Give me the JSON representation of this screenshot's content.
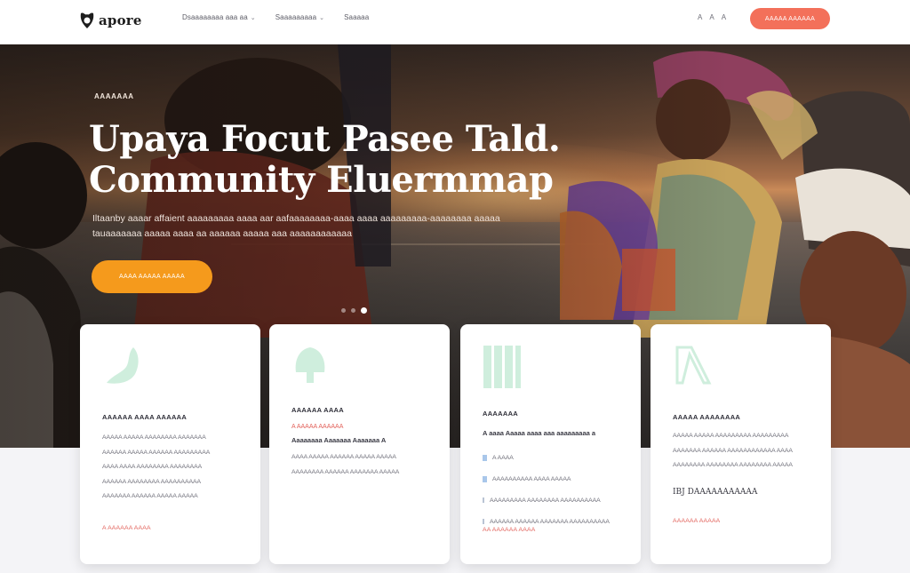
{
  "nav": {
    "logo_text": "apore",
    "links": [
      "Dsaaaaaaaa aaa aa",
      "Saaaaaaaaa",
      "Saaaaa"
    ],
    "right": [
      "A",
      "A",
      "A"
    ],
    "cta_label": "AAAAA AAAAAA"
  },
  "hero": {
    "eyebrow": "AAAAAAA",
    "headline_line1": "Upaya Focut Pasee Tald.",
    "headline_line2": "Community Eluermmap",
    "sub_line1": "Iltaanby aaaar affaient aaaaaaaaa aaaa aar aafaaaaaaaa-aaaa aaaa aaaaaaaaa-aaaaaaaa aaaaa",
    "sub_line2": "tauaaaaaaa aaaaa aaaa aa aaaaaa aaaaa aaa aaaaaaaaaaaa",
    "button_label": "AAAA AAAAA AAAAA",
    "slides": 3,
    "active_slide": 3
  },
  "cards": [
    {
      "title": "AAAAAA AAAA AAAAAA",
      "lines": [
        "AAAAA AAAAA AAAAAAAA AAAAAAA",
        "AAAAAA AAAAA AAAAAA AAAAAAAAA",
        "AAAA AAAA AAAAAAAA AAAAAAAA",
        "AAAAAA AAAAAAAA AAAAAAAAAA",
        "AAAAAAA AAAAAA AAAAA AAAAA"
      ],
      "link": "A AAAAAA AAAA"
    },
    {
      "title": "AAAAAA AAAA",
      "accent": "A AAAAA AAAAAA",
      "sub": "Aaaaaaaa Aaaaaaa Aaaaaaa A",
      "lines": [
        "AAAA AAAAA AAAAAA AAAAA AAAAA",
        "AAAAAAAA AAAAAA AAAAAAA AAAAA"
      ]
    },
    {
      "title": "AAAAAAA",
      "sub": "A aaaa Aaaaa aaaa aaa aaaaaaaaa a",
      "list": [
        "A AAAA",
        "AAAAAAAAAA AAAA AAAAA",
        "AAAAAAAAA AAAAAAAA AAAAAAAAAA",
        "AAAAAA AAAAAA AAAAAAA AAAAAAAAAA"
      ],
      "link": "AA AAAAAA AAAA"
    },
    {
      "title": "AAAAA AAAAAAAA",
      "lines": [
        "AAAAA AAAAA AAAAAAAAA AAAAAAAAA",
        "AAAAAAA AAAAAA AAAAAAAAAAAA AAAA",
        "AAAAAAAA AAAAAAAA AAAAAAAA AAAAA"
      ],
      "strong": "IBJ DAAAAAAAAAAA",
      "link": "AAAAAA AAAAA"
    }
  ],
  "colors": {
    "cta": "#f3705a",
    "hero_button": "#f59a1c",
    "icon_mint": "#cfeedd",
    "accent_text": "#e2615a"
  }
}
